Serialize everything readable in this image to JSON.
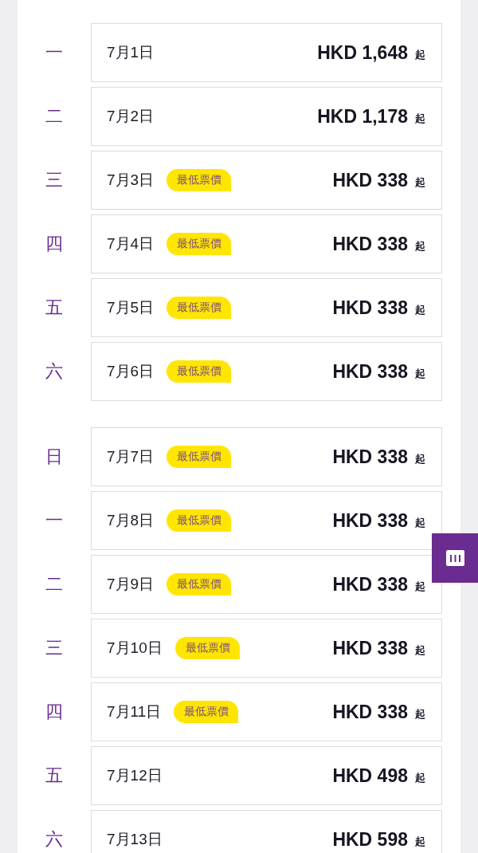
{
  "weeks": [
    {
      "days": [
        {
          "weekday": "一",
          "date": "7月1日",
          "price": "HKD 1,648",
          "suffix": "起"
        },
        {
          "weekday": "二",
          "date": "7月2日",
          "price": "HKD 1,178",
          "suffix": "起"
        },
        {
          "weekday": "三",
          "date": "7月3日",
          "badge": "最低票價",
          "price": "HKD 338",
          "suffix": "起"
        },
        {
          "weekday": "四",
          "date": "7月4日",
          "badge": "最低票價",
          "price": "HKD 338",
          "suffix": "起"
        },
        {
          "weekday": "五",
          "date": "7月5日",
          "badge": "最低票價",
          "price": "HKD 338",
          "suffix": "起"
        },
        {
          "weekday": "六",
          "date": "7月6日",
          "badge": "最低票價",
          "price": "HKD 338",
          "suffix": "起"
        }
      ]
    },
    {
      "days": [
        {
          "weekday": "日",
          "date": "7月7日",
          "badge": "最低票價",
          "price": "HKD 338",
          "suffix": "起"
        },
        {
          "weekday": "一",
          "date": "7月8日",
          "badge": "最低票價",
          "price": "HKD 338",
          "suffix": "起"
        },
        {
          "weekday": "二",
          "date": "7月9日",
          "badge": "最低票價",
          "price": "HKD 338",
          "suffix": "起"
        },
        {
          "weekday": "三",
          "date": "7月10日",
          "badge": "最低票價",
          "price": "HKD 338",
          "suffix": "起"
        },
        {
          "weekday": "四",
          "date": "7月11日",
          "badge": "最低票價",
          "price": "HKD 338",
          "suffix": "起"
        },
        {
          "weekday": "五",
          "date": "7月12日",
          "price": "HKD 498",
          "suffix": "起"
        },
        {
          "weekday": "六",
          "date": "7月13日",
          "price": "HKD 598",
          "suffix": "起"
        }
      ]
    }
  ]
}
